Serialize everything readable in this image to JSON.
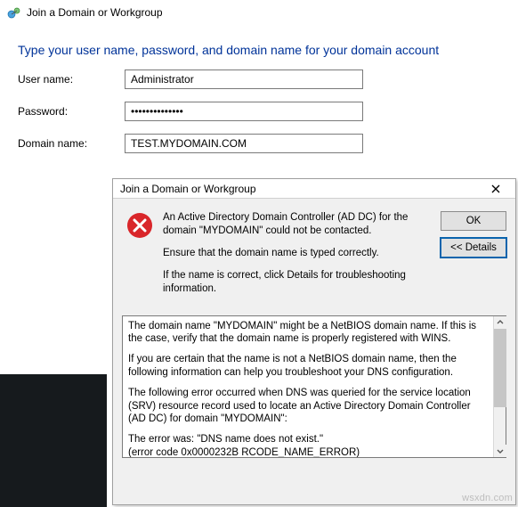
{
  "window": {
    "title": "Join a Domain or Workgroup"
  },
  "heading": "Type your user name, password, and domain name for your domain account",
  "form": {
    "user_label": "User name:",
    "user_value": "Administrator",
    "password_label": "Password:",
    "password_value": "••••••••••••••",
    "domain_label": "Domain name:",
    "domain_value": "TEST.MYDOMAIN.COM"
  },
  "dialog": {
    "title": "Join a Domain or Workgroup",
    "msg1": "An Active Directory Domain Controller (AD DC) for the domain \"MYDOMAIN\" could not be contacted.",
    "msg2": "Ensure that the domain name is typed correctly.",
    "msg3": "If the name is correct, click Details for troubleshooting information.",
    "ok_label": "OK",
    "details_label": "<< Details",
    "details": {
      "p1": "The domain name \"MYDOMAIN\" might be a NetBIOS domain name.  If this is the case, verify that the domain name is properly registered with WINS.",
      "p2": "If you are certain that the name is not a NetBIOS domain name, then the following information can help you troubleshoot your DNS configuration.",
      "p3": "The following error occurred when DNS was queried for the service location (SRV) resource record used to locate an Active Directory Domain Controller (AD DC) for domain \"MYDOMAIN\":",
      "p4": "The error was: \"DNS name does not exist.\"",
      "p5": "(error code 0x0000232B RCODE_NAME_ERROR)"
    }
  },
  "watermark": "wsxdn.com"
}
